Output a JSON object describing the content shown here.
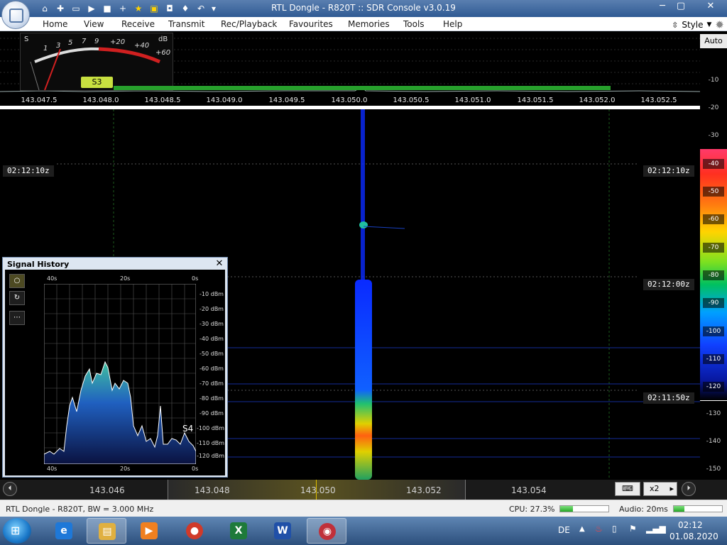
{
  "window": {
    "title": "RTL Dongle - R820T :: SDR Console v3.0.19"
  },
  "menu": {
    "items": [
      "Home",
      "View",
      "Receive",
      "Transmit",
      "Rec/Playback",
      "Favourites",
      "Memories",
      "Tools",
      "Help"
    ],
    "style_label": "Style"
  },
  "smeter": {
    "s_label": "S",
    "db_label": "dB",
    "scale_s": [
      "1",
      "3",
      "5",
      "7",
      "9"
    ],
    "scale_db": [
      "+20",
      "+40",
      "+60"
    ],
    "reading": "S3"
  },
  "freq_ruler": [
    "143.047.5",
    "143.048.0",
    "143.048.5",
    "143.049.0",
    "143.049.5",
    "143.050.0",
    "143.050.5",
    "143.051.0",
    "143.051.5",
    "143.052.0",
    "143.052.5"
  ],
  "right_scale": {
    "auto_label": "Auto",
    "levels_top": [
      "-10",
      "-20",
      "-30"
    ],
    "levels_bottom": [
      "-130",
      "-140",
      "-150"
    ],
    "color_levels": [
      "-40",
      "-50",
      "-60",
      "-70",
      "-80",
      "-90",
      "-100",
      "-110",
      "-120"
    ]
  },
  "waterfall": {
    "time_labels": [
      "02:12:10z",
      "02:12:00z",
      "02:11:50z"
    ]
  },
  "signal_history": {
    "title": "Signal History",
    "time_top": [
      "40s",
      "20s",
      "0s"
    ],
    "time_bottom": [
      "40s",
      "20s",
      "0s"
    ],
    "dbm_levels": [
      "-10 dBm",
      "-20 dBm",
      "-30 dBm",
      "-40 dBm",
      "-50 dBm",
      "-60 dBm",
      "-70 dBm",
      "-80 dBm",
      "-90 dBm",
      "-100 dBm",
      "-110 dBm",
      "-120 dBm"
    ],
    "s_reading": "S4",
    "tools": [
      "circle-icon",
      "refresh-icon",
      "more-icon"
    ],
    "tool_glyphs": [
      "○",
      "↻",
      "⋯"
    ],
    "close_glyph": "✕"
  },
  "bottom_bar": {
    "freqs": [
      "143.046",
      "143.048",
      "143.050",
      "143.052",
      "143.054"
    ],
    "zoom": "x2"
  },
  "status": {
    "device": "RTL Dongle - R820T, BW = 3.000 MHz",
    "cpu": "CPU: 27.3%",
    "cpu_fraction": 0.27,
    "audio": "Audio: 20ms",
    "audio_fraction": 0.22
  },
  "taskbar": {
    "apps": [
      {
        "name": "ie-icon",
        "glyph": "e"
      },
      {
        "name": "explorer-icon",
        "glyph": "▤"
      },
      {
        "name": "media-player-icon",
        "glyph": "▶"
      },
      {
        "name": "chrome-icon",
        "glyph": "●"
      },
      {
        "name": "excel-icon",
        "glyph": "X"
      },
      {
        "name": "word-icon",
        "glyph": "W"
      },
      {
        "name": "sdr-console-icon",
        "glyph": "◉"
      }
    ],
    "lang": "DE",
    "time": "02:12",
    "date": "01.08.2020"
  },
  "colors": {
    "accent": "#2f5a93",
    "signal_green": "#27a02c"
  }
}
